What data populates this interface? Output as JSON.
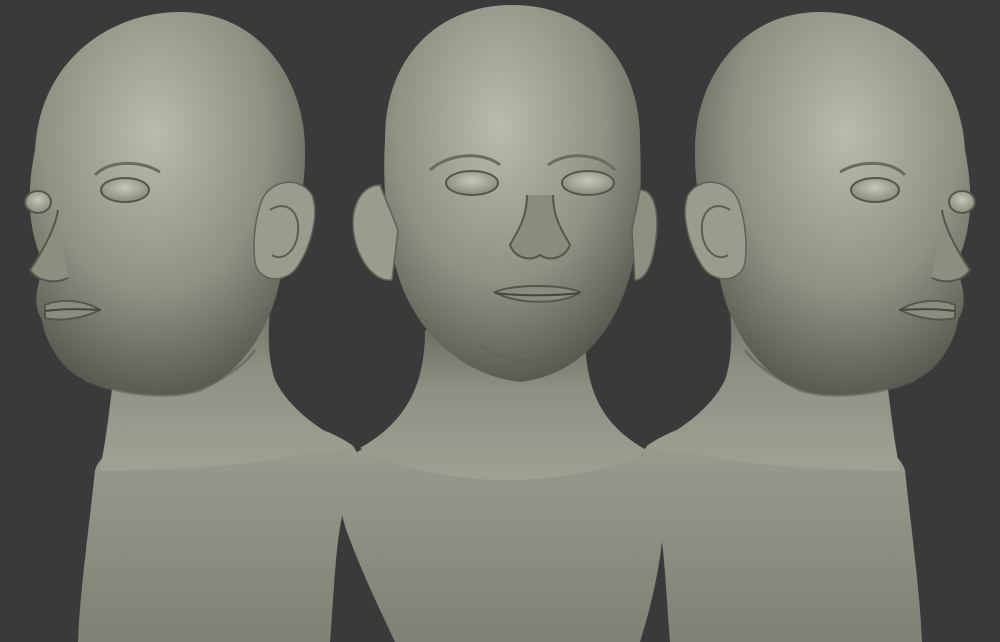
{
  "scene": {
    "background_color": "#3a3a3a",
    "clay_light": "#b9bbac",
    "clay_mid": "#8f9183",
    "clay_dark": "#5c5e53",
    "clay_shadow": "#3f4139",
    "views": [
      {
        "name": "three-quarter-left",
        "icon": "sculpt-head-left"
      },
      {
        "name": "front",
        "icon": "sculpt-head-front"
      },
      {
        "name": "three-quarter-right",
        "icon": "sculpt-head-right"
      }
    ]
  }
}
